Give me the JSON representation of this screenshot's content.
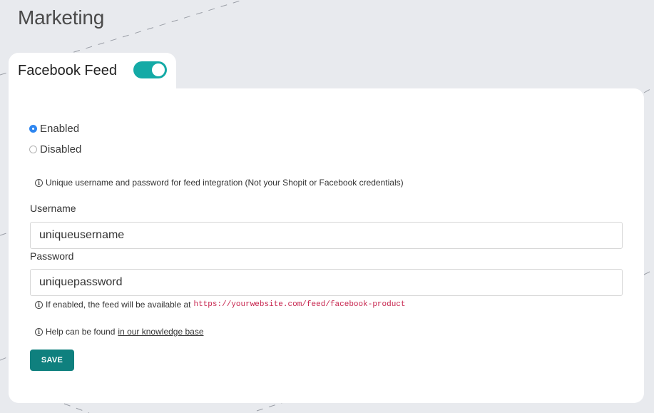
{
  "page": {
    "title": "Marketing"
  },
  "feed_tab": {
    "label": "Facebook Feed",
    "toggle_on": true,
    "accent_color": "#14aaa6"
  },
  "status": {
    "options": [
      {
        "label": "Enabled",
        "selected": true
      },
      {
        "label": "Disabled",
        "selected": false
      }
    ]
  },
  "notes": {
    "credentials": "Unique username and password for feed integration (Not your Shopit or Facebook credentials)",
    "feed_prefix": "If enabled, the feed will be available at",
    "feed_url": "https://yourwebsite.com/feed/facebook-product",
    "help_prefix": "Help can be found",
    "help_link": "in our knowledge base"
  },
  "form": {
    "username_label": "Username",
    "username_value": "uniqueusername",
    "password_label": "Password",
    "password_value": "uniquepassword"
  },
  "actions": {
    "save_label": "SAVE",
    "save_color": "#0f807e"
  },
  "icons": {
    "info": "info-circle-icon"
  }
}
